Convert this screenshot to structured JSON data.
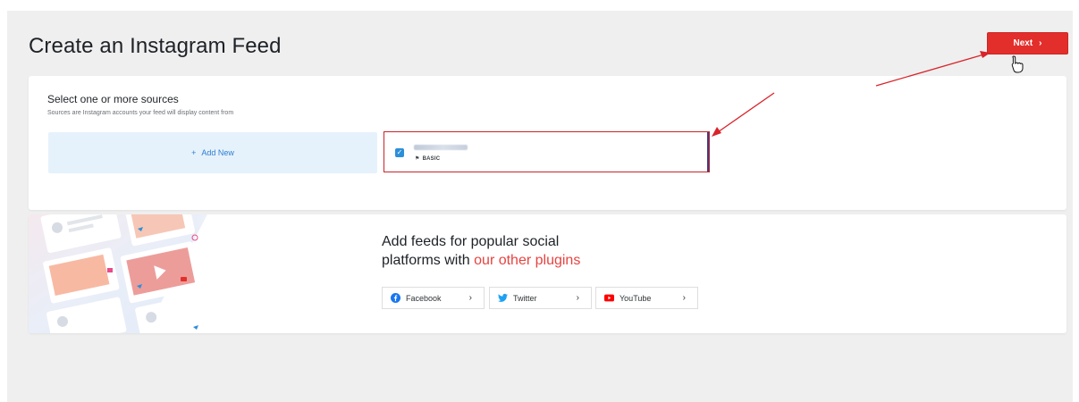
{
  "header": {
    "title": "Create an Instagram Feed",
    "next_label": "Next",
    "next_chevron": "›"
  },
  "sources": {
    "title": "Select one or more sources",
    "subtitle": "Sources are Instagram accounts your feed will display content from",
    "add_new_plus": "+",
    "add_new_label": "Add New",
    "selected_account": {
      "name_redacted": true,
      "type_label": "BASIC",
      "checked": true
    }
  },
  "promo": {
    "heading_line1": "Add feeds for popular social",
    "heading_line2_prefix": "platforms with ",
    "heading_highlight": "our other plugins",
    "plugins": [
      {
        "label": "Facebook",
        "icon": "facebook-icon",
        "chevron": "›"
      },
      {
        "label": "Twitter",
        "icon": "twitter-icon",
        "chevron": "›"
      },
      {
        "label": "YouTube",
        "icon": "youtube-icon",
        "chevron": "›"
      }
    ]
  },
  "colors": {
    "accent_red": "#e22f2c",
    "link_blue": "#2c7dd4",
    "highlight_red": "#e64340",
    "facebook_blue": "#1877f2",
    "twitter_blue": "#1da1f2",
    "youtube_red": "#ff0000"
  }
}
